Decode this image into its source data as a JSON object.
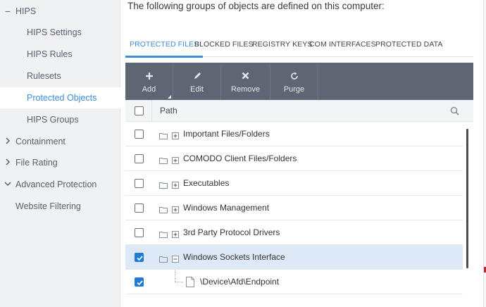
{
  "sidebar": {
    "items": [
      {
        "label": "HIPS",
        "caret": "−"
      },
      {
        "label": "HIPS Settings"
      },
      {
        "label": "HIPS Rules"
      },
      {
        "label": "Rulesets"
      },
      {
        "label": "Protected Objects"
      },
      {
        "label": "HIPS Groups"
      },
      {
        "label": "Containment",
        "caret": "chevron-right"
      },
      {
        "label": "File Rating",
        "caret": "chevron-right"
      },
      {
        "label": "Advanced Protection",
        "caret": "chevron-down"
      },
      {
        "label": "Website Filtering"
      }
    ],
    "active_index": 4
  },
  "main": {
    "heading": "The following groups of objects are defined on this computer:",
    "tabs": [
      {
        "label": "PROTECTED FILES"
      },
      {
        "label": "BLOCKED FILES"
      },
      {
        "label": "REGISTRY KEYS"
      },
      {
        "label": "COM INTERFACES"
      },
      {
        "label": "PROTECTED DATA"
      }
    ],
    "active_tab": 0,
    "toolbar": {
      "add": "Add",
      "edit": "Edit",
      "remove": "Remove",
      "purge": "Purge"
    },
    "table": {
      "column_path": "Path",
      "rows": [
        {
          "label": "Important Files/Folders",
          "checked": false,
          "expanded": false
        },
        {
          "label": "COMODO Client Files/Folders",
          "checked": false,
          "expanded": false
        },
        {
          "label": "Executables",
          "checked": false,
          "expanded": false
        },
        {
          "label": "Windows Management",
          "checked": false,
          "expanded": false
        },
        {
          "label": "3rd Party Protocol Drivers",
          "checked": false,
          "expanded": false
        },
        {
          "label": "Windows Sockets Interface",
          "checked": true,
          "expanded": true
        }
      ],
      "child_rows": [
        {
          "label": "\\Device\\Afd\\Endpoint",
          "checked": true
        }
      ]
    }
  },
  "colors": {
    "accent": "#3c8dd8",
    "toolbar_bg": "#5e6673",
    "sidebar_bg": "#f0f1f3",
    "selected_row": "#dde9f6",
    "checkbox_checked": "#1e7ad2"
  }
}
